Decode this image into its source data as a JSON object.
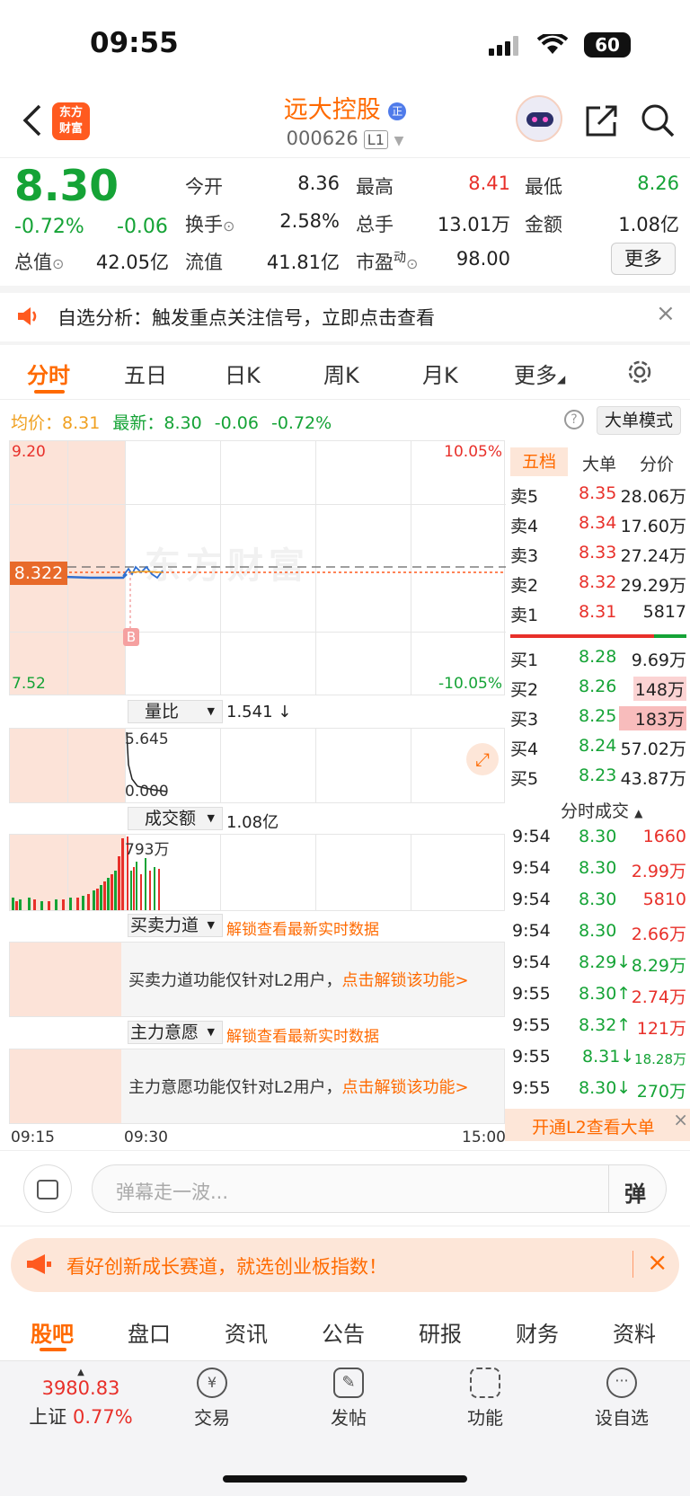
{
  "status": {
    "time": "09:55",
    "battery": "60"
  },
  "header": {
    "name": "远大控股",
    "code": "000626",
    "level": "L1",
    "logo_line1": "东方",
    "logo_line2": "财富"
  },
  "quote": {
    "price": "8.30",
    "change_pct": "-0.72%",
    "change": "-0.06",
    "open_label": "今开",
    "open": "8.36",
    "high_label": "最高",
    "high": "8.41",
    "low_label": "最低",
    "low": "8.26",
    "turnover_label": "换手",
    "turnover": "2.58%",
    "volume_label": "总手",
    "volume": "13.01万",
    "amount_label": "金额",
    "amount": "1.08亿",
    "mcap_label": "总值",
    "mcap": "42.05亿",
    "float_label": "流值",
    "float_cap": "41.81亿",
    "pe_label": "市盈",
    "pe_sup": "动",
    "pe": "98.00",
    "more_label": "更多"
  },
  "notice": {
    "text": "自选分析：触发重点关注信号，立即点击查看"
  },
  "chart_tabs": [
    "分时",
    "五日",
    "日K",
    "周K",
    "月K",
    "更多"
  ],
  "info_bar": {
    "avg_label": "均价：",
    "avg": "8.31",
    "latest_label": "最新：",
    "latest": "8.30",
    "change": "-0.06",
    "change_pct": "-0.72%",
    "mode_button": "大单模式"
  },
  "chart": {
    "y_top": "9.20",
    "y_bottom": "7.52",
    "pct_top": "10.05%",
    "pct_bottom": "-10.05%",
    "price_tag": "8.322",
    "buy_marker": "B",
    "watermark": "东方财富",
    "time_start": "09:15",
    "time_mid": "09:30",
    "time_end": "15:00"
  },
  "indicators": {
    "ratio_label": "量比",
    "ratio_value": "1.541 ↓",
    "ratio_top": "5.645",
    "ratio_bottom": "0.000",
    "amount_label": "成交额",
    "amount_value": "1.08亿",
    "amount_top": "793万",
    "force_label": "买卖力道",
    "force_lock": "解锁查看最新实时数据",
    "force_msg": "买卖力道功能仅针对L2用户，",
    "force_link": "点击解锁该功能>",
    "main_label": "主力意愿",
    "main_lock": "解锁查看最新实时数据",
    "main_msg": "主力意愿功能仅针对L2用户，",
    "main_link": "点击解锁该功能>"
  },
  "orderbook": {
    "tabs": [
      "五档",
      "大单",
      "分价"
    ],
    "asks": [
      {
        "label": "卖5",
        "price": "8.35",
        "vol": "28.06万"
      },
      {
        "label": "卖4",
        "price": "8.34",
        "vol": "17.60万"
      },
      {
        "label": "卖3",
        "price": "8.33",
        "vol": "27.24万"
      },
      {
        "label": "卖2",
        "price": "8.32",
        "vol": "29.29万"
      },
      {
        "label": "卖1",
        "price": "8.31",
        "vol": "5817"
      }
    ],
    "bids": [
      {
        "label": "买1",
        "price": "8.28",
        "vol": "9.69万"
      },
      {
        "label": "买2",
        "price": "8.26",
        "vol": "148万"
      },
      {
        "label": "买3",
        "price": "8.25",
        "vol": "183万"
      },
      {
        "label": "买4",
        "price": "8.24",
        "vol": "57.02万"
      },
      {
        "label": "买5",
        "price": "8.23",
        "vol": "43.87万"
      }
    ],
    "trades_title": "分时成交",
    "trades": [
      {
        "time": "9:54",
        "price": "8.30",
        "vol": "1660"
      },
      {
        "time": "9:54",
        "price": "8.30",
        "vol": "2.99万"
      },
      {
        "time": "9:54",
        "price": "8.30",
        "vol": "5810"
      },
      {
        "time": "9:54",
        "price": "8.30",
        "vol": "2.66万"
      },
      {
        "time": "9:54",
        "price": "8.29↓",
        "vol": "8.29万"
      },
      {
        "time": "9:55",
        "price": "8.30↑",
        "vol": "2.74万"
      },
      {
        "time": "9:55",
        "price": "8.32↑",
        "vol": "121万"
      },
      {
        "time": "9:55",
        "price": "8.31↓",
        "vol": "18.28万"
      },
      {
        "time": "9:55",
        "price": "8.30↓",
        "vol": "270万"
      }
    ],
    "l2_promo": "开通L2查看大单"
  },
  "danmaku": {
    "placeholder": "弹幕走一波...",
    "button": "弹"
  },
  "ad": {
    "text": "看好创新成长赛道，就选创业板指数！"
  },
  "bottom_tabs": [
    "股吧",
    "盘口",
    "资讯",
    "公告",
    "研报",
    "财务",
    "资料"
  ],
  "nav": {
    "index_value": "3980.83",
    "index_name": "上证",
    "index_pct": "0.77%",
    "trade": "交易",
    "post": "发帖",
    "func": "功能",
    "watch": "设自选"
  }
}
